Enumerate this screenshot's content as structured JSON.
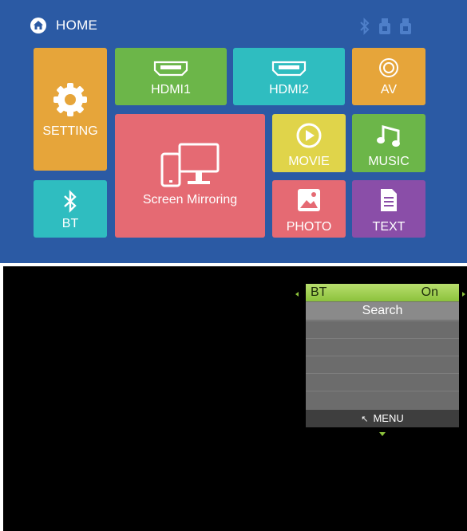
{
  "home": {
    "title": "HOME",
    "status_icons": [
      "bluetooth-icon",
      "usb-icon",
      "usb-icon"
    ],
    "tiles": {
      "setting": {
        "label": "SETTING",
        "icon": "gear-icon",
        "color": "#e6a53a"
      },
      "hdmi1": {
        "label": "HDMI1",
        "icon": "hdmi-icon",
        "color": "#6cb649"
      },
      "hdmi2": {
        "label": "HDMI2",
        "icon": "hdmi-icon",
        "color": "#2fbdc0"
      },
      "av": {
        "label": "AV",
        "icon": "av-icon",
        "color": "#e6a53a"
      },
      "screen_mirroring": {
        "label": "Screen Mirroring",
        "icon": "phone-monitor-icon",
        "color": "#e56a73"
      },
      "movie": {
        "label": "MOVIE",
        "icon": "play-icon",
        "color": "#e0d44a"
      },
      "music": {
        "label": "MUSIC",
        "icon": "music-note-icon",
        "color": "#6cb649"
      },
      "bt": {
        "label": "BT",
        "icon": "bluetooth-icon",
        "color": "#2fbdc0"
      },
      "photo": {
        "label": "PHOTO",
        "icon": "photo-icon",
        "color": "#e56a73"
      },
      "text": {
        "label": "TEXT",
        "icon": "document-icon",
        "color": "#8a4ea8"
      }
    }
  },
  "bt_menu": {
    "header_label": "BT",
    "header_value": "On",
    "items": [
      "Search"
    ],
    "footer_label": "MENU",
    "footer_icon": "back-arrow-icon",
    "accent": "#8cc23c"
  }
}
